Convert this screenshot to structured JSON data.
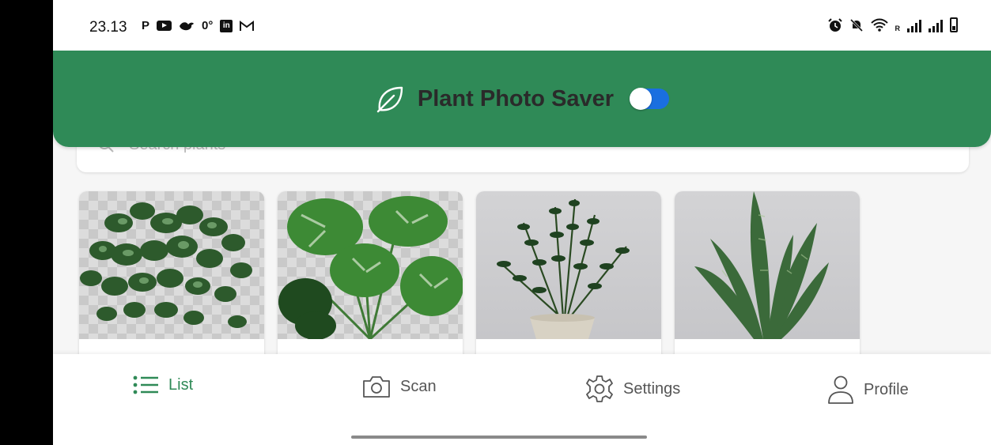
{
  "status_bar": {
    "time": "23.13",
    "left_icons": [
      "P",
      "youtube-icon",
      "bird-icon",
      "0°",
      "linkedin-icon",
      "gmail-icon"
    ],
    "right_icons": [
      "alarm-icon",
      "mute-icon",
      "wifi-icon",
      "signal-icon",
      "signal-icon",
      "battery-icon"
    ],
    "temperature": "0°",
    "p_label": "P",
    "roaming_label": "R"
  },
  "header": {
    "title": "Plant Photo Saver",
    "icon": "leaf-icon",
    "toggle_on": true,
    "background_color": "#2f8a57",
    "toggle_color": "#1a6fe0"
  },
  "search": {
    "icon": "search-icon",
    "placeholder": "Search plants"
  },
  "plants": [
    {
      "name": "",
      "photo": "hanging pothos plant",
      "background": "transparent-checker"
    },
    {
      "name": "",
      "photo": "monstera plant",
      "background": "transparent-checker"
    },
    {
      "name": "",
      "photo": "zz plant in pot",
      "background": "wall"
    },
    {
      "name": "",
      "photo": "snake plant",
      "background": "wall"
    }
  ],
  "bottom_nav": {
    "active": "List",
    "items": [
      {
        "label": "List",
        "icon": "list-icon"
      },
      {
        "label": "Scan",
        "icon": "camera-icon"
      },
      {
        "label": "Settings",
        "icon": "gear-icon"
      },
      {
        "label": "Profile",
        "icon": "user-icon"
      }
    ]
  },
  "colors": {
    "accent": "#2f8a57",
    "nav_inactive": "#555555"
  }
}
